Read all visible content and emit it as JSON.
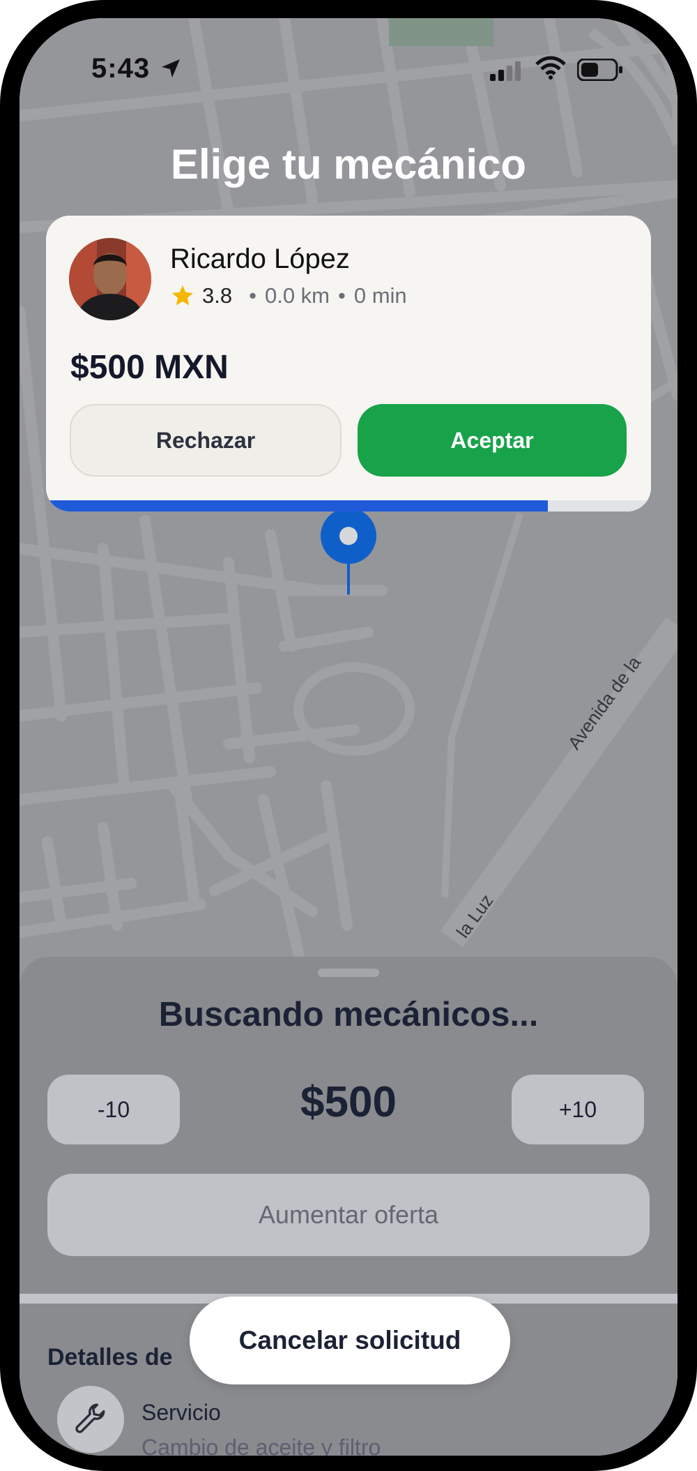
{
  "status_bar": {
    "time": "5:43",
    "icons": [
      "location-arrow-icon",
      "signal-icon",
      "wifi-icon",
      "battery-icon"
    ]
  },
  "screen": {
    "title": "Elige tu mecánico"
  },
  "offer": {
    "mechanic_name": "Ricardo López",
    "rating": "3.8",
    "distance": "0.0 km",
    "eta": "0 min",
    "separator": "•",
    "price": "$500 MXN",
    "reject_label": "Rechazar",
    "accept_label": "Aceptar",
    "timer_remaining_fraction": 0.83
  },
  "map": {
    "street_labels": [
      "Avenida de la",
      "la Luz"
    ]
  },
  "sheet": {
    "status": "Buscando mecánicos...",
    "decrease_label": "-10",
    "increase_label": "+10",
    "offer_amount": "$500",
    "raise_label": "Aumentar oferta",
    "details_title": "Detalles de",
    "service_label": "Servicio",
    "service_value": "Cambio de aceite y filtro",
    "cancel_label": "Cancelar solicitud"
  },
  "colors": {
    "accept": "#18a34a",
    "progress": "#1f5ad8",
    "star": "#f5b700",
    "pin": "#0f5fc8"
  }
}
